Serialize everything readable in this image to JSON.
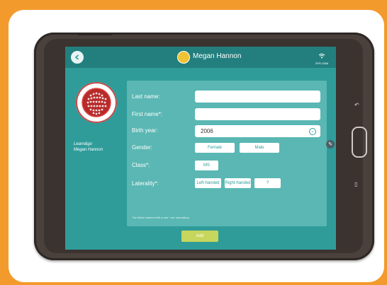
{
  "app": {
    "user_name": "Megan Hannon",
    "wifi_label": "SFR-2958",
    "org_line1": "Learn&go",
    "org_line2": "Megan Hannon"
  },
  "form": {
    "last_name_label": "Last name:",
    "first_name_label": "First name*:",
    "birth_year_label": "Birth year:",
    "birth_year_value": "2006",
    "gender_label": "Gender:",
    "gender_options": [
      "Female",
      "Male"
    ],
    "class_label": "Class*:",
    "class_value": "MS",
    "laterality_label": "Laterality*:",
    "laterality_options": [
      "Left-handed",
      "Right-handed",
      "?"
    ],
    "mandatory_note": "The fields marked with a star * are mandatory.",
    "add_label": "Add"
  },
  "colors": {
    "accent": "#2f9c9a",
    "topbar": "#227f7e",
    "panel": "#5ab7b3",
    "add_button": "#c7d65c",
    "frame": "#f39a2c"
  },
  "icons": [
    "back-arrow-icon",
    "user-avatar-icon",
    "wifi-icon",
    "dropdown-chevron-icon",
    "pencil-icon"
  ]
}
